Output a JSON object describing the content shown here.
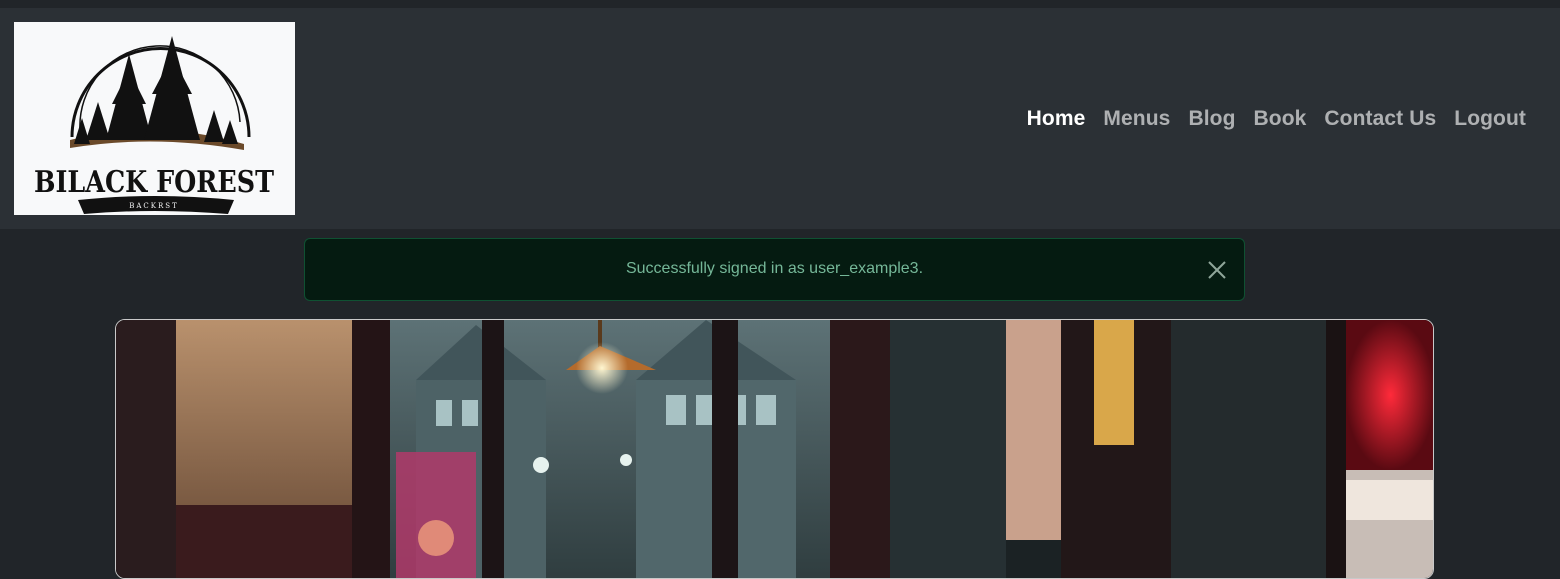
{
  "brand": {
    "name": "BILACK FOREST",
    "tagline": "BACKRST"
  },
  "nav": {
    "items": [
      {
        "label": "Home",
        "active": true
      },
      {
        "label": "Menus",
        "active": false
      },
      {
        "label": "Blog",
        "active": false
      },
      {
        "label": "Book",
        "active": false
      },
      {
        "label": "Contact Us",
        "active": false
      },
      {
        "label": "Logout",
        "active": false
      }
    ]
  },
  "alert": {
    "message": "Successfully signed in as user_example3.",
    "close_icon": "close-icon"
  },
  "hero": {
    "image": "restaurant-interior-photo"
  },
  "colors": {
    "navbar_bg": "#2b3035",
    "page_bg": "#212529",
    "alert_bg": "#051b11",
    "alert_text": "#75b798"
  }
}
